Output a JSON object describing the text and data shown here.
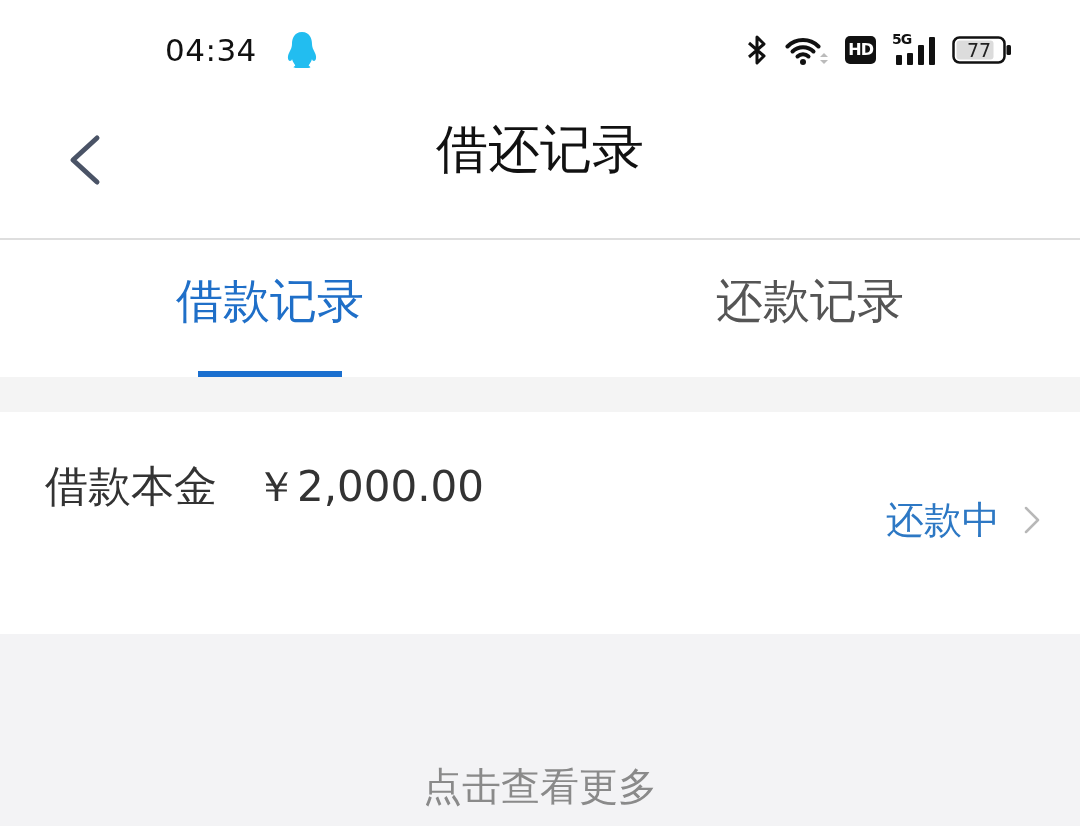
{
  "status_bar": {
    "time": "04:34",
    "hd_label": "HD",
    "network_type": "5G",
    "battery": "77"
  },
  "header": {
    "title": "借还记录"
  },
  "tabs": [
    {
      "label": "借款记录",
      "selected": true
    },
    {
      "label": "还款记录",
      "selected": false
    }
  ],
  "records": [
    {
      "label": "借款本金",
      "amount": "￥2,000.00",
      "status": "还款中"
    }
  ],
  "load_more": "点击查看更多"
}
